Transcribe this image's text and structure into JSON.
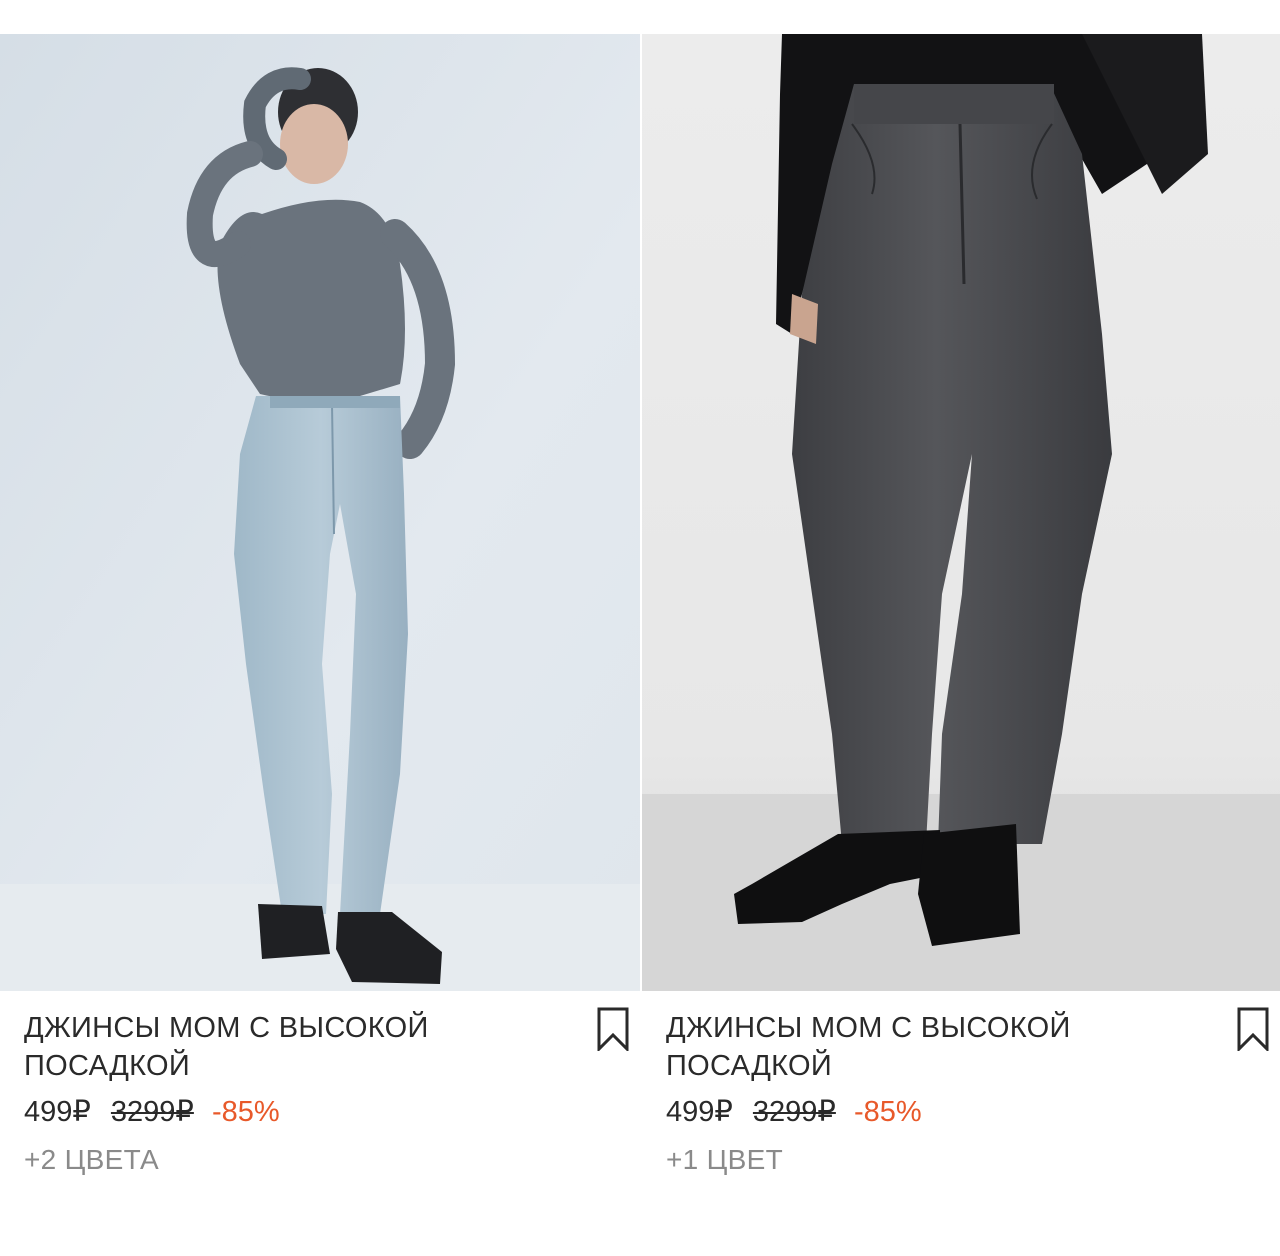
{
  "products": [
    {
      "title": "ДЖИНСЫ MOM С ВЫСОКОЙ ПОСАДКОЙ",
      "price_current": "499₽",
      "price_old": "3299₽",
      "discount": "-85%",
      "colors_note": "+2 ЦВЕТА",
      "image_icon": "product-photo-light-jeans",
      "bookmark_icon": "bookmark-icon"
    },
    {
      "title": "ДЖИНСЫ MOM С ВЫСОКОЙ ПОСАДКОЙ",
      "price_current": "499₽",
      "price_old": "3299₽",
      "discount": "-85%",
      "colors_note": "+1 ЦВЕТ",
      "image_icon": "product-photo-dark-jeans",
      "bookmark_icon": "bookmark-icon"
    }
  ],
  "colors": {
    "discount": "#e8592a",
    "text": "#2a2a2a",
    "muted": "#8a8a8a"
  }
}
